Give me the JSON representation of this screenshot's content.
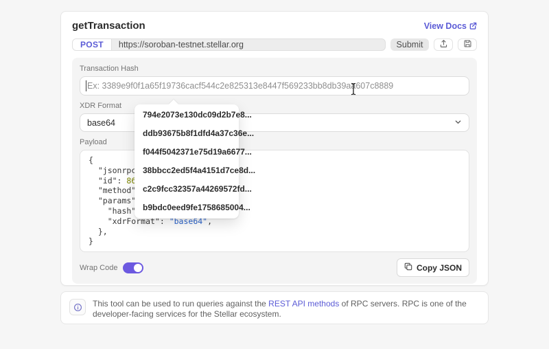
{
  "colors": {
    "accent": "#5b5bd6",
    "toggle_on": "#6c59e0",
    "code_number": "#7d8600",
    "code_string": "#2a63cc"
  },
  "header": {
    "title": "getTransaction",
    "view_docs_label": "View Docs"
  },
  "request": {
    "method": "POST",
    "url": "https://soroban-testnet.stellar.org",
    "submit_label": "Submit"
  },
  "form": {
    "tx_hash_label": "Transaction Hash",
    "tx_hash_placeholder": "Ex: 3389e9f0f1a65f19736cacf544c2e825313e8447f569233bb8db39aa607c8889",
    "xdr_format_label": "XDR Format",
    "xdr_format_value": "base64",
    "payload_label": "Payload",
    "wrap_code_label": "Wrap Code",
    "copy_json_label": "Copy JSON"
  },
  "suggestions": [
    "794e2073e130dc09d2b7e8...",
    "ddb93675b8f1dfd4a37c36e...",
    "f044f5042371e75d19a6677...",
    "38bbcc2ed5f4a4151d7ce8d...",
    "c2c9fcc32357a44269572fd...",
    "b9bdc0eed9fe1758685004..."
  ],
  "payload": {
    "lines": [
      [
        [
          "plain",
          "{"
        ]
      ],
      [
        [
          "plain",
          "  \"jsonrpc\": "
        ]
      ],
      [
        [
          "plain",
          "  \"id\": "
        ],
        [
          "num",
          "86753"
        ]
      ],
      [
        [
          "plain",
          "  \"method\": \""
        ]
      ],
      [
        [
          "plain",
          "  \"params\": {"
        ]
      ],
      [
        [
          "plain",
          "    \"hash\": "
        ],
        [
          "str",
          "\"\""
        ],
        [
          "plain",
          ","
        ]
      ],
      [
        [
          "plain",
          "    \"xdrFormat\": "
        ],
        [
          "str",
          "\"base64\""
        ],
        [
          "plain",
          ","
        ]
      ],
      [
        [
          "plain",
          "  },"
        ]
      ],
      [
        [
          "plain",
          "}"
        ]
      ]
    ]
  },
  "note": {
    "pre": "This tool can be used to run queries against the ",
    "link": "REST API methods",
    "post": " of RPC servers. RPC is one of the developer-facing services for the Stellar ecosystem."
  }
}
